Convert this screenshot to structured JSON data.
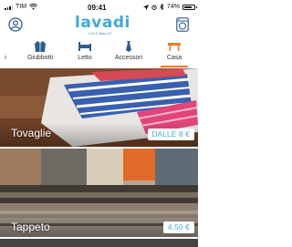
{
  "status_bar": {
    "carrier": "TIM",
    "time": "09:41",
    "battery": "74%"
  },
  "header": {
    "logo": "lavadi",
    "version": "1.19.2 Beta 10"
  },
  "categories": [
    {
      "label": "i",
      "icon": "shirt-icon"
    },
    {
      "label": "Giubbotti",
      "icon": "jacket-icon"
    },
    {
      "label": "Letto",
      "icon": "bed-icon"
    },
    {
      "label": "Accessori",
      "icon": "tie-icon"
    },
    {
      "label": "Casa",
      "icon": "table-icon"
    }
  ],
  "active_category": "Casa",
  "colors": {
    "brand": "#3fa9d8",
    "active_tab": "#f07830"
  },
  "cards": [
    {
      "title": "Tovaglie",
      "price": "DALLE 8 €"
    },
    {
      "title": "Tappeto",
      "price": "4,50 €"
    }
  ]
}
